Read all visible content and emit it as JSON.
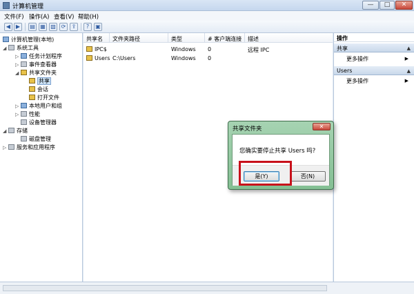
{
  "window": {
    "title": "计算机管理",
    "min": "—",
    "max": "□",
    "close": "✕"
  },
  "menu": [
    "文件(F)",
    "操作(A)",
    "查看(V)",
    "帮助(H)"
  ],
  "toolbar": [
    "◀",
    "▶",
    "▤",
    "▦",
    "▧",
    "⟳",
    "⇪",
    "?",
    "▣"
  ],
  "tree": [
    {
      "label": "计算机管理(本地)",
      "icon": "computer-icon"
    },
    {
      "label": "系统工具",
      "icon": "tools-icon",
      "arrow": "◢"
    },
    {
      "label": "任务计划程序",
      "icon": "clock-icon",
      "arrow": "▷"
    },
    {
      "label": "事件查看器",
      "icon": "event-icon",
      "arrow": "▷"
    },
    {
      "label": "共享文件夹",
      "icon": "folder-icon",
      "arrow": "◢"
    },
    {
      "label": "共享",
      "icon": "folder-icon"
    },
    {
      "label": "会话",
      "icon": "folder-icon"
    },
    {
      "label": "打开文件",
      "icon": "folder-icon"
    },
    {
      "label": "本地用户和组",
      "icon": "users-icon",
      "arrow": "▷"
    },
    {
      "label": "性能",
      "icon": "performance-icon",
      "arrow": "▷"
    },
    {
      "label": "设备管理器",
      "icon": "device-icon"
    },
    {
      "label": "存储",
      "icon": "storage-icon",
      "arrow": "◢"
    },
    {
      "label": "磁盘管理",
      "icon": "disk-icon"
    },
    {
      "label": "服务和应用程序",
      "icon": "services-icon",
      "arrow": "▷"
    }
  ],
  "columns": [
    "共享名",
    "文件夹路径",
    "类型",
    "# 客户端连接",
    "描述"
  ],
  "rows": [
    [
      "IPC$",
      "",
      "Windows",
      "0",
      "远程 IPC"
    ],
    [
      "Users",
      "C:\\Users",
      "Windows",
      "0",
      ""
    ]
  ],
  "actions": {
    "header": "操作",
    "sections": [
      {
        "title": "共享",
        "item": "更多操作"
      },
      {
        "title": "Users",
        "item": "更多操作"
      }
    ],
    "caret": "▲",
    "arrow": "▶"
  },
  "dialog": {
    "title": "共享文件夹",
    "close": "✕",
    "message": "您确实要停止共享 Users 吗?",
    "yes": "是(Y)",
    "no": "否(N)"
  }
}
